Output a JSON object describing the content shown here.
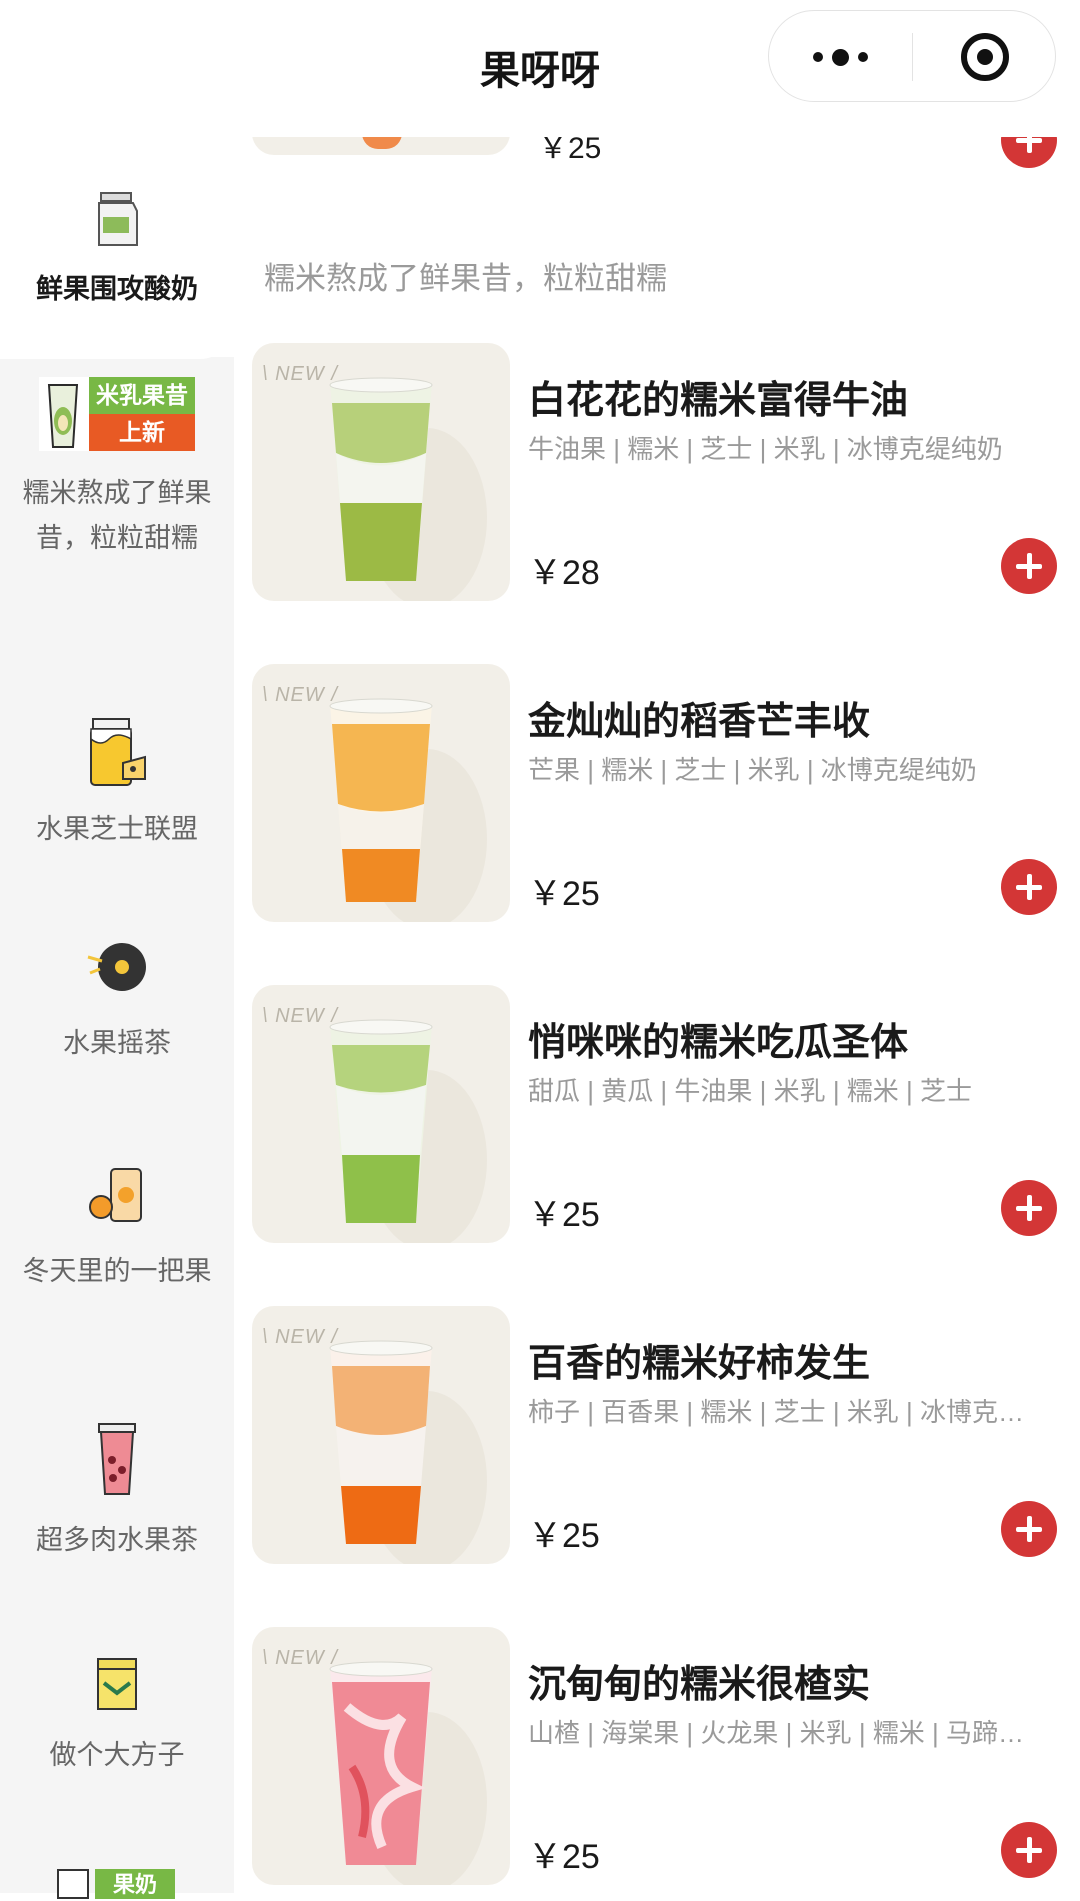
{
  "app": {
    "title": "果呀呀"
  },
  "capsule": {
    "more_icon": "more-dots-icon",
    "close_icon": "target-close-icon"
  },
  "sidebar": {
    "items": [
      {
        "label": "鲜果围攻酸奶",
        "icon": "milk-carton-icon"
      },
      {
        "label": "糯米熬成了鲜果昔，粒粒甜糯",
        "banner_top": "米乳果昔",
        "banner_bottom": "上新",
        "icon": "new-product-banner"
      },
      {
        "label": "水果芝士联盟",
        "icon": "cheese-jar-icon"
      },
      {
        "label": "水果摇茶",
        "icon": "vinyl-record-icon"
      },
      {
        "label": "冬天里的一把果",
        "icon": "orange-jar-icon"
      },
      {
        "label": "超多肉水果茶",
        "icon": "fruit-tea-cup-icon"
      },
      {
        "label": "做个大方子",
        "icon": "tea-can-icon"
      },
      {
        "label": "果奶",
        "icon": "fruit-milk-banner"
      }
    ]
  },
  "content": {
    "partial_top": {
      "price": "￥25"
    },
    "section_title": "糯米熬成了鲜果昔，粒粒甜糯",
    "new_badge": "\\ NEW /",
    "products": [
      {
        "name": "白花花的糯米富得牛油",
        "tags": "牛油果 | 糯米 | 芝士 | 米乳 | 冰博克缇纯奶",
        "price": "￥28",
        "colors": {
          "top": "#b7d07a",
          "bottom": "#9cba45"
        }
      },
      {
        "name": "金灿灿的稻香芒丰收",
        "tags": "芒果 | 糯米 | 芝士 | 米乳 | 冰博克缇纯奶",
        "price": "￥25",
        "colors": {
          "top": "#f5b651",
          "bottom": "#f08a23"
        }
      },
      {
        "name": "悄咪咪的糯米吃瓜圣体",
        "tags": "甜瓜 | 黄瓜 | 牛油果 | 米乳 | 糯米 | 芝士",
        "price": "￥25",
        "colors": {
          "top": "#b5d37d",
          "bottom": "#8fc04a"
        }
      },
      {
        "name": "百香的糯米好柿发生",
        "tags": "柿子 | 百香果 | 糯米 | 芝士 | 米乳 | 冰博克…",
        "price": "￥25",
        "colors": {
          "top": "#f3b275",
          "bottom": "#ee6b14"
        }
      },
      {
        "name": "沉甸甸的糯米很楂实",
        "tags": "山楂 | 海棠果 | 火龙果 | 米乳 | 糯米 | 马蹄…",
        "price": "￥25",
        "colors": {
          "top": "#f08a95",
          "bottom": "#e0525d"
        }
      }
    ]
  }
}
